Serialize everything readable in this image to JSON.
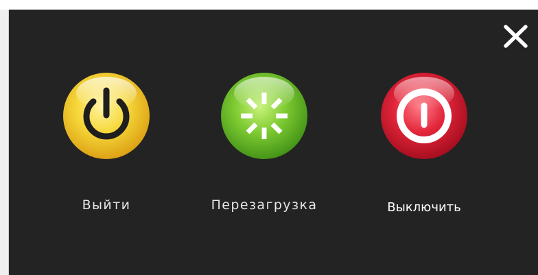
{
  "dialog": {
    "close_icon": "close-icon",
    "actions": [
      {
        "id": "logout",
        "label": "Выйти",
        "icon": "power-icon",
        "color": "#f2cc28"
      },
      {
        "id": "restart",
        "label": "Перезагрузка",
        "icon": "restart-spinner-icon",
        "color": "#6bbf2a"
      },
      {
        "id": "shutdown",
        "label": "Выключить",
        "icon": "shutdown-icon",
        "color": "#d8182c"
      }
    ]
  },
  "colors": {
    "panel_background": "#232323",
    "label_text": "#e6e6e6",
    "close_icon": "#ffffff"
  }
}
